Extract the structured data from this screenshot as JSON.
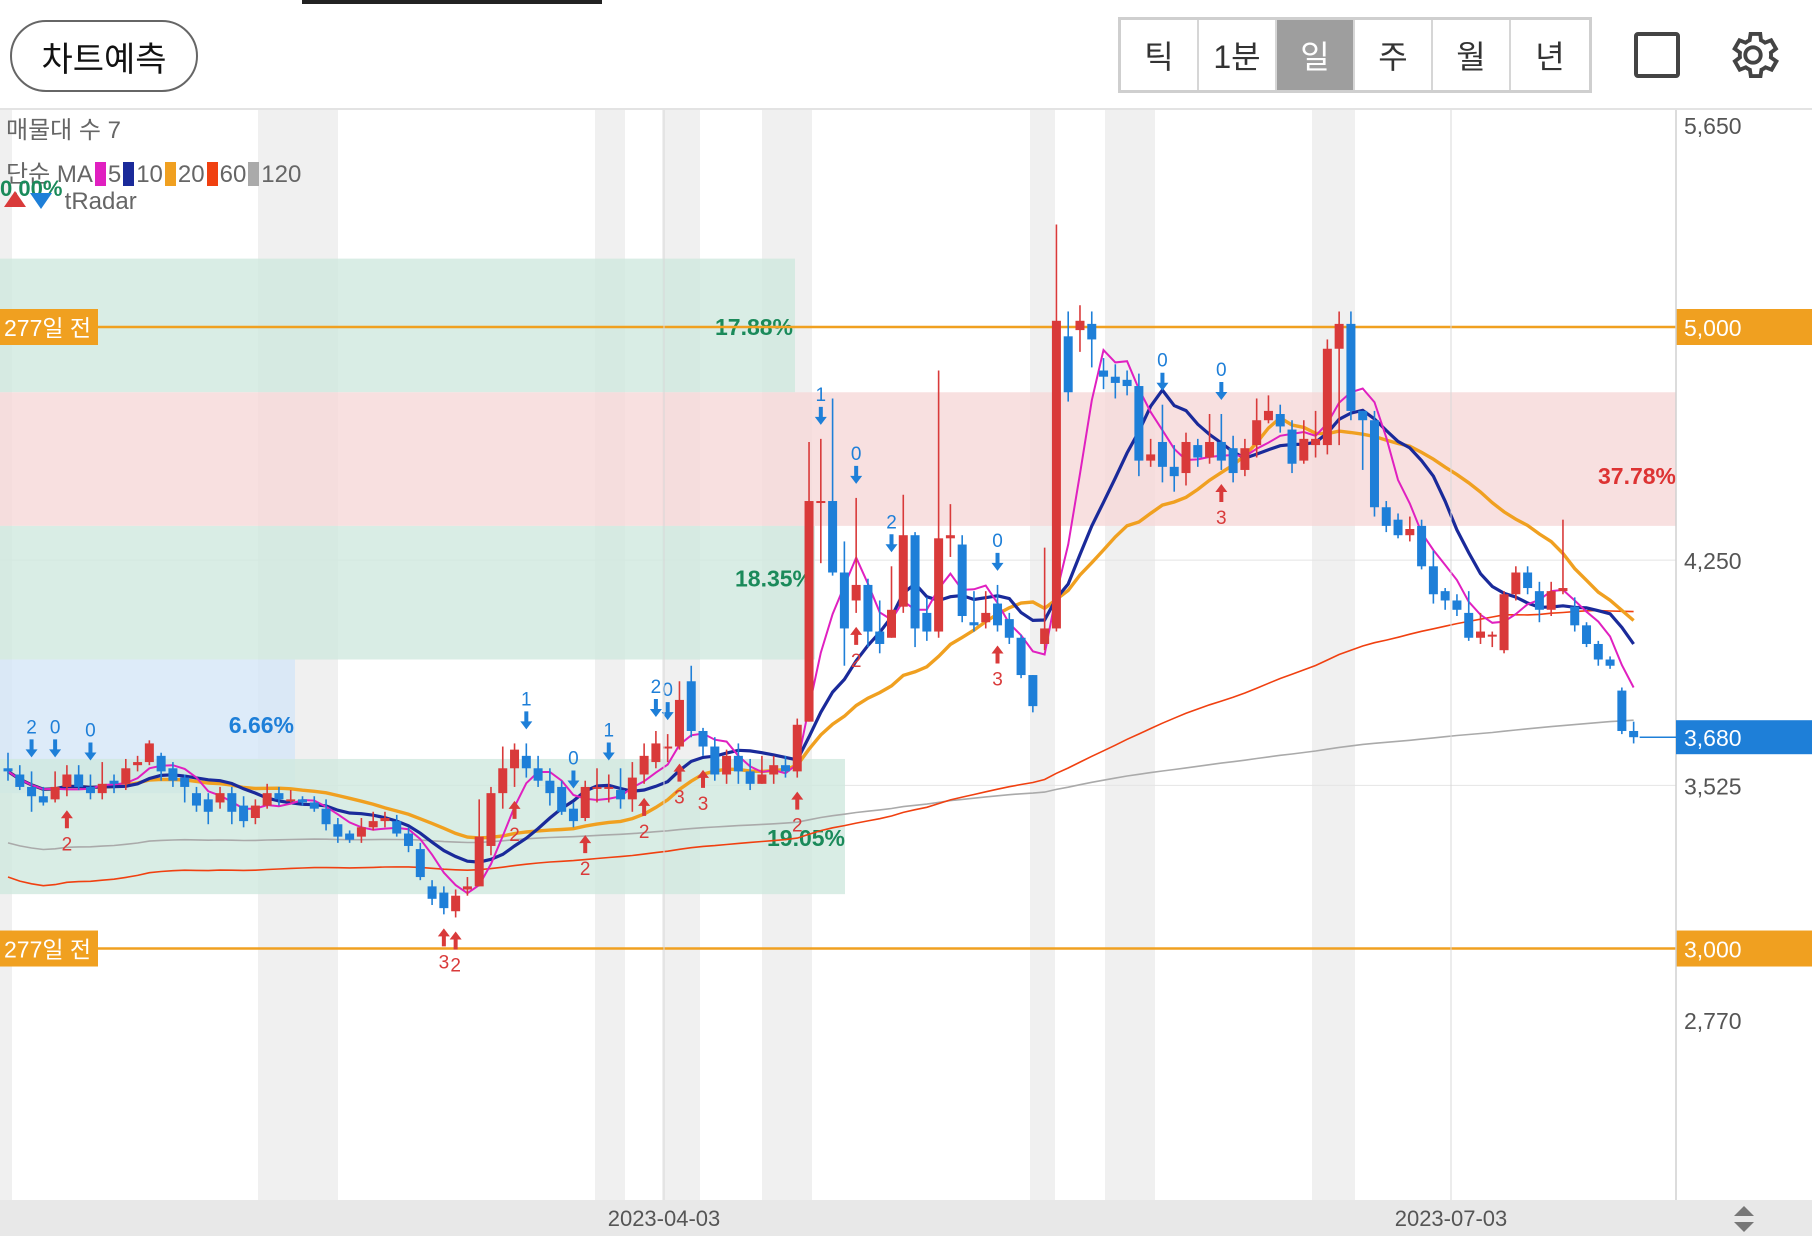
{
  "toolbar": {
    "predict_label": "차트예측",
    "periods": [
      "틱",
      "1분",
      "일",
      "주",
      "월",
      "년"
    ],
    "active_period": "일"
  },
  "legend": {
    "volume_profile": "매물대 수 7",
    "ma_prefix": "단순 MA",
    "ma": [
      {
        "label": "5",
        "color": "#e020c0"
      },
      {
        "label": "10",
        "color": "#1a2a9a"
      },
      {
        "label": "20",
        "color": "#f0a020"
      },
      {
        "label": "60",
        "color": "#f04010"
      },
      {
        "label": "120",
        "color": "#aaaaaa"
      }
    ],
    "zero_pct": "0.00%",
    "tradar": "tRadar"
  },
  "colors": {
    "up": "#d93a3a",
    "down": "#1e7fd8",
    "ref_line": "#f0a020",
    "current_price_bg": "#1e7fd8",
    "pct_green": "#1a8a5a",
    "pct_red": "#d33",
    "pct_blue": "#1e7fd8"
  },
  "chart_data": {
    "type": "candlestick",
    "period": "일",
    "y_axis_labels": [
      "5,650",
      "4,250",
      "3,525",
      "2,770"
    ],
    "ylim": [
      2700,
      5700
    ],
    "x_axis_labels": [
      "2023-04-03",
      "2023-07-03"
    ],
    "reference_lines": [
      {
        "price": 5000,
        "value_label": "5,000",
        "tag": "277일 전"
      },
      {
        "price": 3000,
        "value_label": "3,000",
        "tag": "277일 전"
      }
    ],
    "current_price": {
      "value": 3680,
      "label": "3,680"
    },
    "zone_labels": [
      {
        "text": "17.88%",
        "color": "green"
      },
      {
        "text": "37.78%",
        "color": "red"
      },
      {
        "text": "18.35%",
        "color": "green"
      },
      {
        "text": "6.66%",
        "color": "blue"
      },
      {
        "text": "19.05%",
        "color": "green"
      }
    ],
    "signal_digits_down": [
      "2",
      "0",
      "0",
      "1",
      "0",
      "1",
      "2",
      "0",
      "1",
      "0",
      "2",
      "0",
      "0",
      "0"
    ],
    "signal_digits_up": [
      "2",
      "3",
      "2",
      "2",
      "2",
      "2",
      "3",
      "3",
      "2",
      "2",
      "3",
      "3"
    ],
    "candles": [
      [
        3580,
        3570,
        3630,
        3540
      ],
      [
        3560,
        3520,
        3590,
        3510
      ],
      [
        3520,
        3490,
        3570,
        3440
      ],
      [
        3490,
        3470,
        3520,
        3460
      ],
      [
        3480,
        3520,
        3570,
        3470
      ],
      [
        3520,
        3560,
        3590,
        3490
      ],
      [
        3560,
        3520,
        3590,
        3510
      ],
      [
        3520,
        3500,
        3560,
        3480
      ],
      [
        3500,
        3530,
        3600,
        3480
      ],
      [
        3540,
        3530,
        3560,
        3500
      ],
      [
        3530,
        3580,
        3610,
        3510
      ],
      [
        3590,
        3600,
        3620,
        3570
      ],
      [
        3600,
        3660,
        3670,
        3590
      ],
      [
        3620,
        3570,
        3630,
        3540
      ],
      [
        3580,
        3540,
        3600,
        3520
      ],
      [
        3550,
        3520,
        3560,
        3470
      ],
      [
        3500,
        3460,
        3520,
        3440
      ],
      [
        3480,
        3440,
        3500,
        3400
      ],
      [
        3470,
        3500,
        3520,
        3450
      ],
      [
        3500,
        3440,
        3520,
        3400
      ],
      [
        3460,
        3410,
        3490,
        3390
      ],
      [
        3420,
        3460,
        3480,
        3400
      ],
      [
        3460,
        3500,
        3530,
        3450
      ],
      [
        3500,
        3480,
        3520,
        3460
      ],
      [
        3480,
        3480,
        3510,
        3470
      ],
      [
        3480,
        3470,
        3490,
        3460
      ],
      [
        3470,
        3450,
        3490,
        3440
      ],
      [
        3450,
        3400,
        3480,
        3380
      ],
      [
        3400,
        3360,
        3420,
        3340
      ],
      [
        3370,
        3350,
        3380,
        3340
      ],
      [
        3360,
        3390,
        3420,
        3340
      ],
      [
        3390,
        3410,
        3440,
        3380
      ],
      [
        3410,
        3420,
        3440,
        3390
      ],
      [
        3410,
        3370,
        3430,
        3360
      ],
      [
        3370,
        3330,
        3390,
        3310
      ],
      [
        3320,
        3230,
        3340,
        3220
      ],
      [
        3200,
        3160,
        3220,
        3140
      ],
      [
        3180,
        3130,
        3200,
        3110
      ],
      [
        3120,
        3170,
        3190,
        3100
      ],
      [
        3190,
        3200,
        3230,
        3170
      ],
      [
        3200,
        3360,
        3480,
        3200
      ],
      [
        3330,
        3500,
        3520,
        3300
      ],
      [
        3500,
        3580,
        3650,
        3450
      ],
      [
        3580,
        3640,
        3660,
        3520
      ],
      [
        3620,
        3580,
        3660,
        3550
      ],
      [
        3580,
        3540,
        3620,
        3520
      ],
      [
        3540,
        3500,
        3580,
        3460
      ],
      [
        3520,
        3440,
        3540,
        3430
      ],
      [
        3450,
        3410,
        3470,
        3390
      ],
      [
        3420,
        3520,
        3540,
        3410
      ],
      [
        3520,
        3520,
        3580,
        3470
      ],
      [
        3520,
        3520,
        3560,
        3470
      ],
      [
        3510,
        3480,
        3580,
        3450
      ],
      [
        3480,
        3550,
        3600,
        3440
      ],
      [
        3560,
        3620,
        3660,
        3530
      ],
      [
        3600,
        3660,
        3700,
        3580
      ],
      [
        3650,
        3650,
        3690,
        3600
      ],
      [
        3650,
        3800,
        3860,
        3640
      ],
      [
        3860,
        3700,
        3910,
        3680
      ],
      [
        3700,
        3650,
        3710,
        3620
      ],
      [
        3650,
        3560,
        3680,
        3540
      ],
      [
        3560,
        3620,
        3640,
        3530
      ],
      [
        3620,
        3570,
        3660,
        3530
      ],
      [
        3570,
        3530,
        3610,
        3510
      ],
      [
        3530,
        3560,
        3620,
        3530
      ],
      [
        3560,
        3590,
        3620,
        3530
      ],
      [
        3590,
        3570,
        3620,
        3550
      ],
      [
        3570,
        3720,
        3740,
        3550
      ],
      [
        3730,
        4440,
        4630,
        3730
      ],
      [
        4440,
        4440,
        4640,
        4240
      ],
      [
        4440,
        4210,
        4770,
        4200
      ],
      [
        4210,
        4030,
        4310,
        3910
      ],
      [
        4120,
        4170,
        4450,
        4080
      ],
      [
        4170,
        4020,
        4190,
        3970
      ],
      [
        4020,
        3980,
        4120,
        3950
      ],
      [
        4000,
        4090,
        4230,
        4000
      ],
      [
        4100,
        4330,
        4460,
        4080
      ],
      [
        4330,
        4030,
        4340,
        3970
      ],
      [
        4080,
        4020,
        4130,
        3990
      ],
      [
        4020,
        4320,
        4860,
        4000
      ],
      [
        4320,
        4330,
        4430,
        4260
      ],
      [
        4300,
        4070,
        4330,
        4050
      ],
      [
        4050,
        4040,
        4150,
        4020
      ],
      [
        4050,
        4080,
        4150,
        4030
      ],
      [
        4110,
        4040,
        4170,
        4020
      ],
      [
        4060,
        4000,
        4080,
        3980
      ],
      [
        4000,
        3880,
        4010,
        3870
      ],
      [
        3880,
        3780,
        3880,
        3760
      ],
      [
        3980,
        4030,
        4290,
        3960
      ],
      [
        4030,
        5020,
        5330,
        4020
      ],
      [
        4970,
        4790,
        5050,
        4760
      ],
      [
        4990,
        5020,
        5070,
        4920
      ],
      [
        5010,
        4960,
        5050,
        4870
      ],
      [
        4860,
        4840,
        4900,
        4800
      ],
      [
        4840,
        4820,
        4880,
        4770
      ],
      [
        4830,
        4810,
        4860,
        4780
      ],
      [
        4810,
        4570,
        4850,
        4520
      ],
      [
        4570,
        4590,
        4640,
        4550
      ],
      [
        4630,
        4550,
        4750,
        4500
      ],
      [
        4550,
        4520,
        4620,
        4470
      ],
      [
        4530,
        4630,
        4660,
        4490
      ],
      [
        4620,
        4580,
        4640,
        4550
      ],
      [
        4580,
        4630,
        4720,
        4560
      ],
      [
        4630,
        4570,
        4720,
        4540
      ],
      [
        4610,
        4530,
        4650,
        4500
      ],
      [
        4540,
        4610,
        4640,
        4520
      ],
      [
        4620,
        4700,
        4770,
        4580
      ],
      [
        4700,
        4730,
        4780,
        4690
      ],
      [
        4720,
        4680,
        4750,
        4660
      ],
      [
        4670,
        4560,
        4700,
        4530
      ],
      [
        4570,
        4640,
        4700,
        4560
      ],
      [
        4620,
        4640,
        4730,
        4580
      ],
      [
        4620,
        4930,
        4960,
        4590
      ],
      [
        4930,
        5010,
        5050,
        4620
      ],
      [
        5010,
        4730,
        5050,
        4700
      ],
      [
        4730,
        4700,
        4730,
        4540
      ],
      [
        4700,
        4420,
        4730,
        4390
      ],
      [
        4420,
        4360,
        4440,
        4340
      ],
      [
        4380,
        4330,
        4400,
        4320
      ],
      [
        4330,
        4350,
        4390,
        4310
      ],
      [
        4360,
        4230,
        4380,
        4220
      ],
      [
        4230,
        4140,
        4280,
        4110
      ],
      [
        4150,
        4120,
        4160,
        4090
      ],
      [
        4120,
        4090,
        4140,
        4070
      ],
      [
        4080,
        4000,
        4150,
        3990
      ],
      [
        4000,
        4020,
        4080,
        3980
      ],
      [
        4010,
        4010,
        4020,
        3970
      ],
      [
        3960,
        4140,
        4150,
        3950
      ],
      [
        4140,
        4210,
        4230,
        4120
      ],
      [
        4210,
        4160,
        4230,
        4140
      ],
      [
        4150,
        4090,
        4180,
        4050
      ],
      [
        4090,
        4150,
        4180,
        4070
      ],
      [
        4150,
        4160,
        4380,
        4140
      ],
      [
        4100,
        4040,
        4130,
        4020
      ],
      [
        4040,
        3980,
        4050,
        3970
      ],
      [
        3980,
        3930,
        3990,
        3910
      ],
      [
        3930,
        3910,
        3940,
        3900
      ],
      [
        3830,
        3700,
        3840,
        3690
      ],
      [
        3700,
        3680,
        3730,
        3660
      ]
    ]
  }
}
